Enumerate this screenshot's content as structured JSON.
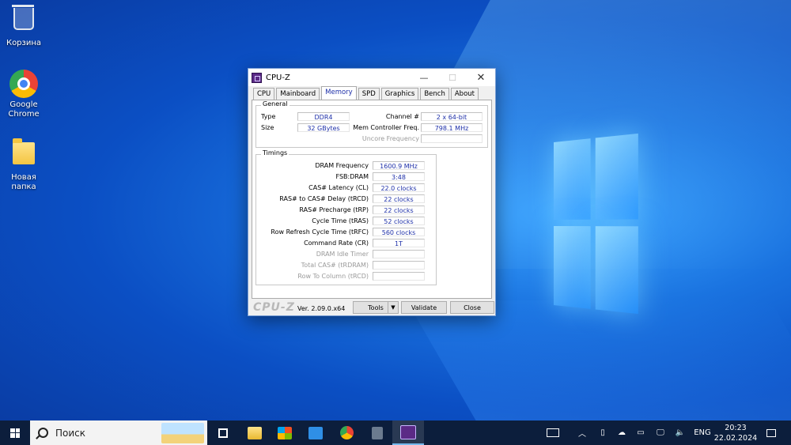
{
  "desktop": {
    "icons": [
      {
        "label": "Корзина"
      },
      {
        "label": "Google Chrome"
      },
      {
        "label": "Новая папка"
      }
    ]
  },
  "window": {
    "title": "CPU-Z",
    "tabs": [
      "CPU",
      "Mainboard",
      "Memory",
      "SPD",
      "Graphics",
      "Bench",
      "About"
    ],
    "active_tab": "Memory",
    "general": {
      "group_label": "General",
      "type_label": "Type",
      "type_value": "DDR4",
      "size_label": "Size",
      "size_value": "32 GBytes",
      "channel_label": "Channel #",
      "channel_value": "2 x 64-bit",
      "mem_ctrl_label": "Mem Controller Freq.",
      "mem_ctrl_value": "798.1 MHz",
      "uncore_label": "Uncore Frequency",
      "uncore_value": ""
    },
    "timings": {
      "group_label": "Timings",
      "rows": [
        {
          "label": "DRAM Frequency",
          "value": "1600.9 MHz",
          "enabled": true
        },
        {
          "label": "FSB:DRAM",
          "value": "3:48",
          "enabled": true
        },
        {
          "label": "CAS# Latency (CL)",
          "value": "22.0 clocks",
          "enabled": true
        },
        {
          "label": "RAS# to CAS# Delay (tRCD)",
          "value": "22 clocks",
          "enabled": true
        },
        {
          "label": "RAS# Precharge (tRP)",
          "value": "22 clocks",
          "enabled": true
        },
        {
          "label": "Cycle Time (tRAS)",
          "value": "52 clocks",
          "enabled": true
        },
        {
          "label": "Row Refresh Cycle Time (tRFC)",
          "value": "560 clocks",
          "enabled": true
        },
        {
          "label": "Command Rate (CR)",
          "value": "1T",
          "enabled": true
        },
        {
          "label": "DRAM Idle Timer",
          "value": "",
          "enabled": false
        },
        {
          "label": "Total CAS# (tRDRAM)",
          "value": "",
          "enabled": false
        },
        {
          "label": "Row To Column (tRCD)",
          "value": "",
          "enabled": false
        }
      ]
    },
    "footer": {
      "brand": "CPU-Z",
      "version": "Ver. 2.09.0.x64",
      "tools_label": "Tools",
      "validate_label": "Validate",
      "close_label": "Close"
    }
  },
  "taskbar": {
    "search_placeholder": "Поиск",
    "language": "ENG",
    "time": "20:23",
    "date": "22.02.2024"
  }
}
